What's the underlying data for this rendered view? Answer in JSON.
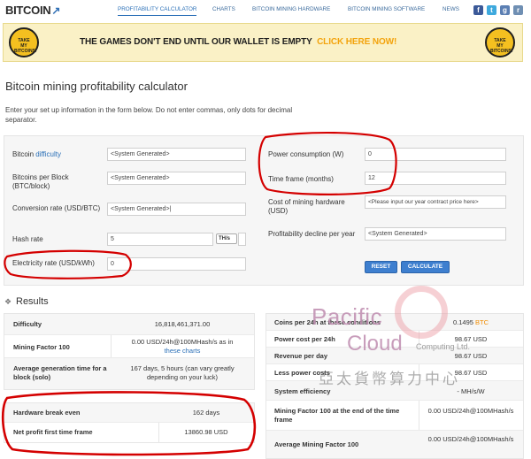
{
  "header": {
    "logo_text": "BITCOIN",
    "nav": [
      "PROFITABILITY CALCULATOR",
      "CHARTS",
      "BITCOIN MINING HARDWARE",
      "BITCOIN MINING SOFTWARE",
      "NEWS"
    ],
    "social": [
      {
        "icon": "facebook-icon",
        "glyph": "f",
        "color": "#3b5998"
      },
      {
        "icon": "twitter-icon",
        "glyph": "t",
        "color": "#3ea9dd"
      },
      {
        "icon": "google-plus-icon",
        "glyph": "g",
        "color": "#5b7fb3"
      },
      {
        "icon": "rss-icon",
        "glyph": "r",
        "color": "#6f8fb3"
      }
    ]
  },
  "banner": {
    "text": "THE GAMES DON'T END UNTIL OUR WALLET IS EMPTY",
    "cta": "CLICK HERE NOW!",
    "badge_text": "TAKE MY BITCOINS!"
  },
  "page": {
    "title": "Bitcoin mining profitability calculator",
    "intro": "Enter your set up information in the form below. Do not enter commas, only dots for decimal separator."
  },
  "form": {
    "left": [
      {
        "label_pre": "Bitcoin ",
        "label_link": "difficulty",
        "value": "<System Generated>"
      },
      {
        "label": "Bitcoins per Block (BTC/block)",
        "value": "<System Generated>"
      },
      {
        "label": "Conversion rate (USD/BTC)",
        "value": "<System Generated>|"
      },
      {
        "label": "Hash rate",
        "value": "5",
        "unit": "TH/s"
      },
      {
        "label": "Electricity rate (USD/kWh)",
        "value": "0"
      }
    ],
    "right": [
      {
        "label": "Power consumption (W)",
        "value": "0"
      },
      {
        "label": "Time frame (months)",
        "value": "12"
      },
      {
        "label": "Cost of mining hardware (USD)",
        "value": "<Please input our year contract price here>"
      },
      {
        "label": "Profitability decline per year",
        "value": "<System Generated>"
      }
    ],
    "reset_label": "RESET",
    "calculate_label": "CALCULATE"
  },
  "results": {
    "title": "Results",
    "left": [
      {
        "label": "Difficulty",
        "value": "16,818,461,371.00"
      },
      {
        "label": "Mining Factor 100",
        "value_pre": "0.00 USD/24h@100MHash/s as in",
        "value_link": "these charts"
      },
      {
        "label": "Average generation time for a block (solo)",
        "value": "167 days, 5 hours (can vary greatly depending on your luck)"
      }
    ],
    "left2": [
      {
        "label": "Hardware break even",
        "value": "162 days"
      },
      {
        "label": "Net profit first time frame",
        "value": "13860.98 USD"
      }
    ],
    "right": [
      {
        "label": "Coins per 24h at these conditions",
        "value_num": "0.1495",
        "value_unit": "BTC"
      },
      {
        "label": "Power cost per 24h",
        "value": "98.67 USD"
      },
      {
        "label": "Revenue per day",
        "value": "98.67 USD"
      },
      {
        "label": "Less power costs",
        "value": "98.67 USD"
      },
      {
        "label": "System efficiency",
        "value": "- MH/s/W"
      },
      {
        "label": "Mining Factor 100 at the end of the time frame",
        "value": "0.00 USD/24h@100MHash/s"
      },
      {
        "label": "Average Mining Factor 100",
        "value": "0.00 USD/24h@100MHash/s"
      }
    ]
  },
  "watermark": {
    "line1": "Pacific",
    "line2": "Cloud",
    "line3": "Computing Ltd.",
    "line4": "亞太貨幣算力中心"
  },
  "annotation_color": "#d40000"
}
